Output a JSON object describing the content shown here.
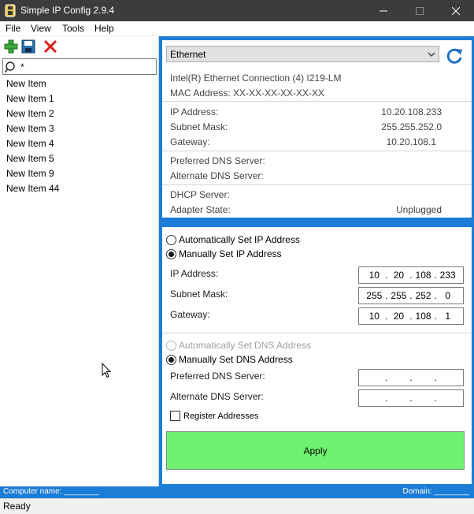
{
  "window": {
    "title": "Simple IP Config 2.9.4"
  },
  "menu": [
    {
      "label": "File"
    },
    {
      "label": "View"
    },
    {
      "label": "Tools"
    },
    {
      "label": "Help"
    }
  ],
  "toolbar": {
    "add_icon": "plus-icon",
    "save_icon": "floppy-icon",
    "delete_icon": "x-icon"
  },
  "search": {
    "value": "*"
  },
  "profiles": [
    "New Item",
    "New Item 1",
    "New Item 2",
    "New Item 3",
    "New Item 4",
    "New Item 5",
    "New Item 9",
    "New Item 44"
  ],
  "adapter": {
    "selected": "Ethernet",
    "description": "Intel(R) Ethernet Connection (4) I219-LM",
    "mac": "MAC Address: XX-XX-XX-XX-XX-XX"
  },
  "current": {
    "ip_label": "IP Address:",
    "ip_value": "10.20.108.233",
    "subnet_label": "Subnet Mask:",
    "subnet_value": "255.255.252.0",
    "gateway_label": "Gateway:",
    "gateway_value": "10.20.108.1",
    "pref_dns_label": "Preferred DNS Server:",
    "alt_dns_label": "Alternate DNS Server:",
    "dhcp_label": "DHCP Server:",
    "state_label": "Adapter State:",
    "state_value": "Unplugged"
  },
  "config": {
    "auto_ip": "Automatically Set IP Address",
    "manual_ip": "Manually Set IP Address",
    "ip_label": "IP Address:",
    "ip": [
      "10",
      "20",
      "108",
      "233"
    ],
    "subnet_label": "Subnet Mask:",
    "subnet": [
      "255",
      "255",
      "252",
      "0"
    ],
    "gateway_label": "Gateway:",
    "gateway": [
      "10",
      "20",
      "108",
      "1"
    ],
    "auto_dns": "Automatically Set DNS Address",
    "manual_dns": "Manually Set DNS Address",
    "pref_dns_label": "Preferred DNS Server:",
    "alt_dns_label": "Alternate DNS Server:",
    "register": "Register Addresses",
    "apply": "Apply"
  },
  "infobar": {
    "computer": "Computer name: ________",
    "domain": "Domain: ________"
  },
  "status": {
    "text": "Ready"
  },
  "colors": {
    "accent": "#1c7dd6",
    "apply": "#6ff26f",
    "titlebar": "#3c3c3c"
  }
}
